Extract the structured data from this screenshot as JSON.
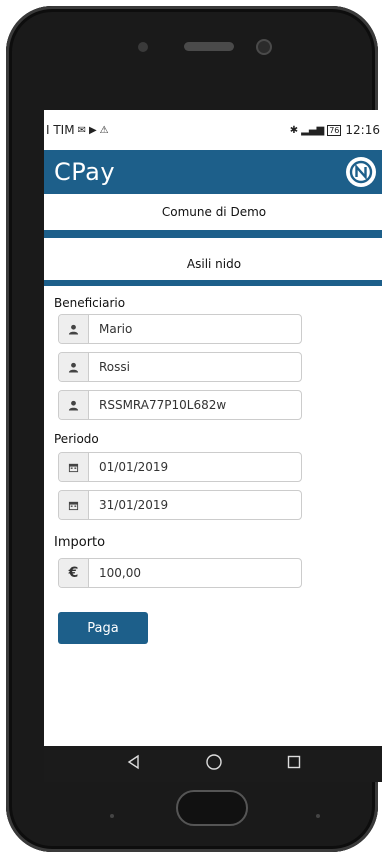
{
  "statusbar": {
    "carrier": "I TIM",
    "battery": "76",
    "time": "12:16"
  },
  "app": {
    "title": "CPay"
  },
  "municipality": "Comune di Demo",
  "service": "Asili nido",
  "beneficiary": {
    "label": "Beneficiario",
    "first_name": "Mario",
    "last_name": "Rossi",
    "tax_code": "RSSMRA77P10L682w"
  },
  "period": {
    "label": "Periodo",
    "start": "01/01/2019",
    "end": "31/01/2019"
  },
  "amount": {
    "label": "Importo",
    "currency_symbol": "€",
    "value": "100,00"
  },
  "actions": {
    "pay_label": "Paga"
  },
  "colors": {
    "primary": "#1d5f8a",
    "navbar": "#1b1b1b"
  },
  "icons": [
    "user-icon",
    "calendar-icon",
    "euro-icon",
    "app-logo-icon",
    "back-nav-icon",
    "home-nav-icon",
    "recents-nav-icon"
  ]
}
